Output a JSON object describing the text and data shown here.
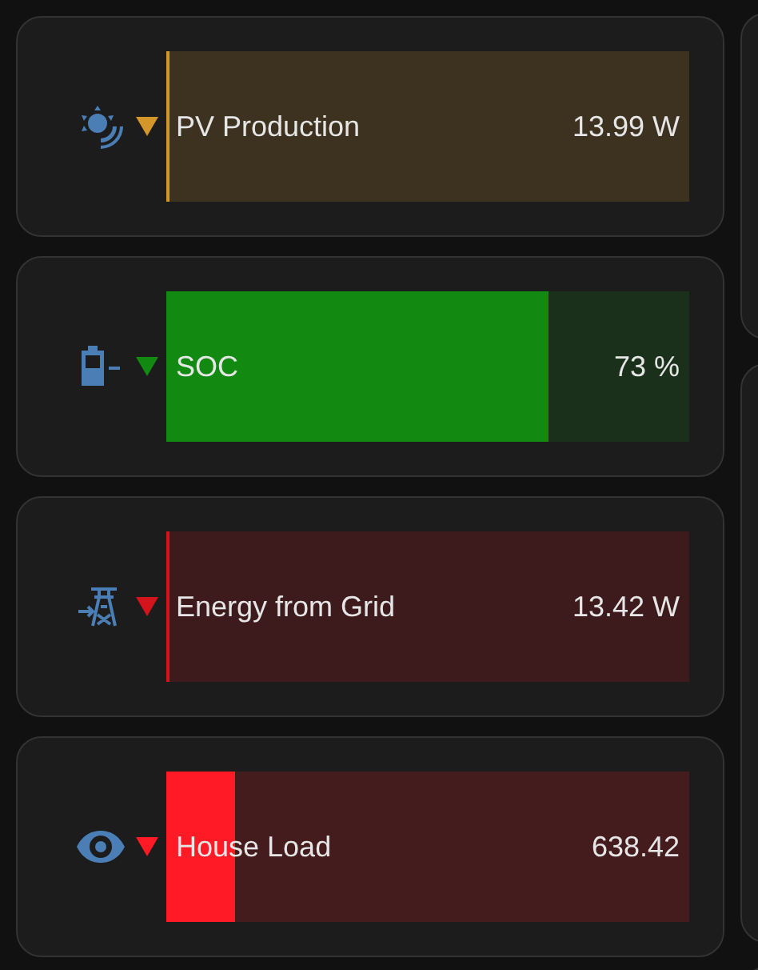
{
  "entities": [
    {
      "name": "PV Production",
      "value": "13.99 W",
      "level": 0.005,
      "color": "#d4952a"
    },
    {
      "name": "SOC",
      "value": "73 %",
      "level": 0.73,
      "color": "#128a12"
    },
    {
      "name": "Energy from Grid",
      "value": "13.42 W",
      "level": 0.005,
      "color": "#d4141c"
    },
    {
      "name": "House Load",
      "value": "638.42",
      "level": 0.13,
      "color": "#ff1a25"
    }
  ]
}
